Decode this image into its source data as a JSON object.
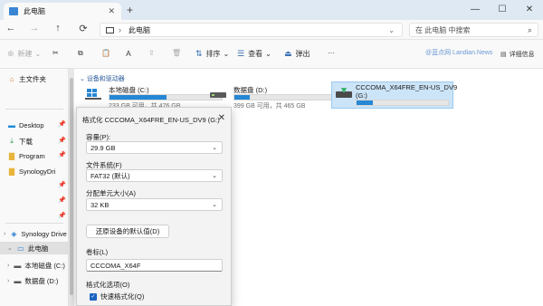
{
  "tab": {
    "title": "此电脑"
  },
  "window": {
    "minimize": "—",
    "maximize": "☐",
    "close": "✕"
  },
  "address": {
    "path": "此电脑",
    "search_placeholder": "在 此电脑 中搜索"
  },
  "toolbar": {
    "new_label": "新建",
    "sort_label": "排序",
    "view_label": "查看",
    "eject_label": "弹出",
    "more_label": "···",
    "watermark": "@蓝点网 Landian.News",
    "details_label": "详细信息"
  },
  "sidebar": {
    "home": "主文件夹",
    "quick": [
      {
        "label": "Desktop"
      },
      {
        "label": "下载"
      },
      {
        "label": "Program"
      },
      {
        "label": "SynologyDri"
      }
    ],
    "synology": "Synology Drive",
    "this_pc": "此电脑",
    "drives": [
      {
        "label": "本地磁盘 (C:)"
      },
      {
        "label": "数据盘 (D:)"
      }
    ]
  },
  "main": {
    "section_title": "设备和驱动器",
    "drives": [
      {
        "name": "本地磁盘 (C:)",
        "size": "233 GB 可用，共 476 GB",
        "used_fraction": 0.51
      },
      {
        "name": "数据盘 (D:)",
        "size": "399 GB 可用，共 465 GB",
        "used_fraction": 0.14
      },
      {
        "name": "CCCOMA_X64FRE_EN-US_DV9",
        "name2": "(G:)",
        "used_fraction": 0.18
      }
    ]
  },
  "dialog": {
    "title": "格式化 CCCOMA_X64FRE_EN-US_DV9 (G:)",
    "capacity_label": "容量(P):",
    "capacity_value": "29.9 GB",
    "fs_label": "文件系统(F)",
    "fs_value": "FAT32 (默认)",
    "alloc_label": "分配单元大小(A)",
    "alloc_value": "32 KB",
    "restore_button": "还原设备的默认值(D)",
    "volume_label": "卷标(L)",
    "volume_value": "CCCOMA_X64F",
    "options_label": "格式化选项(O)",
    "quick_format_label": "快速格式化(Q)"
  },
  "colors": {
    "accent": "#2687d4",
    "selection": "#cce4f7"
  }
}
